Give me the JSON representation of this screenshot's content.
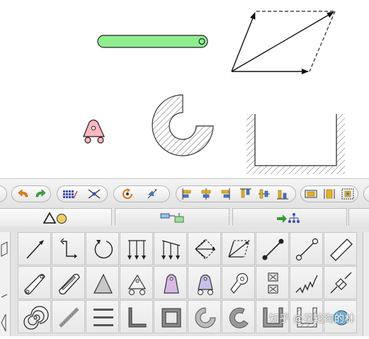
{
  "app": {
    "watermark": "知乎 @花轮淘的林"
  },
  "canvas": {
    "shapes": [
      "slider-bar",
      "parallelogram-vector-diagram",
      "wheeled-block",
      "partial-annulus",
      "u-channel-ground"
    ]
  },
  "toolbar": {
    "groups": [
      {
        "name": "history",
        "buttons": [
          "undo",
          "redo"
        ]
      },
      {
        "name": "grid-snap",
        "buttons": [
          "grid",
          "snap-cross"
        ]
      },
      {
        "name": "transform",
        "buttons": [
          "rotate",
          "mirror"
        ]
      },
      {
        "name": "align",
        "buttons": [
          "align-left",
          "align-center-h",
          "align-right",
          "align-top",
          "align-center-v",
          "align-bottom"
        ]
      },
      {
        "name": "distribute",
        "buttons": [
          "distribute-h",
          "distribute-v",
          "fit"
        ]
      }
    ]
  },
  "tabs": [
    {
      "name": "shapes",
      "icon": "triangle-circle-icon"
    },
    {
      "name": "connectors",
      "icon": "flowchart-icon"
    },
    {
      "name": "hierarchy",
      "icon": "tree-arrow-icon"
    }
  ],
  "palette": {
    "rows": [
      [
        "arrow",
        "elbow-connector",
        "rotation-arrow",
        "parallel-down-arrows",
        "slanted-down-arrows",
        "force-diamond-arrows",
        "vector-parallelogram",
        "dot-link",
        "hollow-dot-link",
        "bar"
      ],
      [
        "pin-link",
        "slotted-link",
        "triangle-support",
        "roller-support",
        "pivot-support-purple",
        "roller-pivot-support-purple",
        "hook-pivot",
        "boxed-slider",
        "spring",
        "damper"
      ],
      [
        "spiral",
        "rod",
        "parallel-lines",
        "l-bracket",
        "square-block",
        "partial-ring",
        "gray-partial-ring",
        "u-channel",
        "u-channel-hatched",
        "gear"
      ]
    ]
  },
  "colors": {
    "accent_green": "#90ee90",
    "pink": "#ffb6c1",
    "purple": "#d8b8e8",
    "undo_orange": "#e8801a",
    "redo_green": "#3ca63c",
    "hierarchy_green": "#2e9e2e"
  }
}
